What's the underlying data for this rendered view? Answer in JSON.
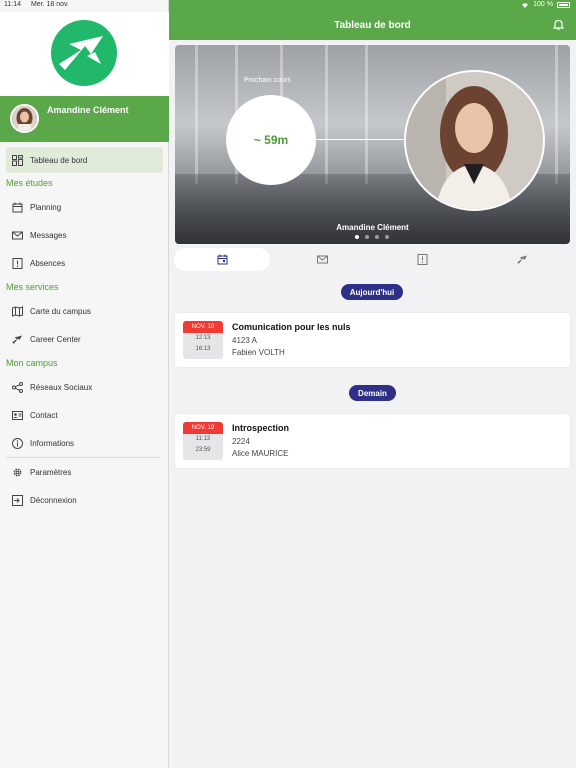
{
  "status_bar": {
    "time": "11:14",
    "date": "Mer. 18 nov.",
    "battery": "100 %"
  },
  "colors": {
    "brand_green": "#5aa84a",
    "logo_green": "#22b86b",
    "navy": "#2e2f86",
    "date_red": "#ef3b33"
  },
  "sidebar": {
    "user_name": "Amandine Clément",
    "top_item": {
      "label": "Tableau de bord",
      "icon": "dashboard-icon"
    },
    "sections": [
      {
        "title": "Mes études",
        "items": [
          {
            "label": "Planning",
            "icon": "calendar-icon"
          },
          {
            "label": "Messages",
            "icon": "mail-icon"
          },
          {
            "label": "Absences",
            "icon": "alert-icon"
          }
        ]
      },
      {
        "title": "Mes services",
        "items": [
          {
            "label": "Carte du campus",
            "icon": "map-icon"
          },
          {
            "label": "Career Center",
            "icon": "star-icon"
          }
        ]
      },
      {
        "title": "Mon campus",
        "items": [
          {
            "label": "Réseaux Sociaux",
            "icon": "share-icon"
          },
          {
            "label": "Contact",
            "icon": "contact-card-icon"
          },
          {
            "label": "Informations",
            "icon": "info-icon"
          }
        ]
      }
    ],
    "footer_items": [
      {
        "label": "Paramètres",
        "icon": "gear-icon"
      },
      {
        "label": "Déconnexion",
        "icon": "logout-icon"
      }
    ]
  },
  "header": {
    "title": "Tableau de bord"
  },
  "hero": {
    "next_label": "Prochain cours",
    "countdown": "~ 59m",
    "person_name": "Amandine Clément",
    "active_dot": 0,
    "dot_count": 4
  },
  "tabs": [
    {
      "icon": "calendar-icon",
      "active": true
    },
    {
      "icon": "mail-icon",
      "active": false
    },
    {
      "icon": "alert-icon",
      "active": false
    },
    {
      "icon": "star-icon",
      "active": false
    }
  ],
  "schedule": [
    {
      "day_label": "Aujourd'hui",
      "events": [
        {
          "date": "NOV. 18",
          "start": "12:13",
          "end": "16:13",
          "title": "Comunication pour les nuls",
          "room": "4123 A",
          "teacher": "Fabien VOLTH"
        }
      ]
    },
    {
      "day_label": "Demain",
      "events": [
        {
          "date": "NOV. 19",
          "start": "11:13",
          "end": "23:59",
          "title": "Introspection",
          "room": "2224",
          "teacher": "Alice MAURICE"
        }
      ]
    }
  ]
}
